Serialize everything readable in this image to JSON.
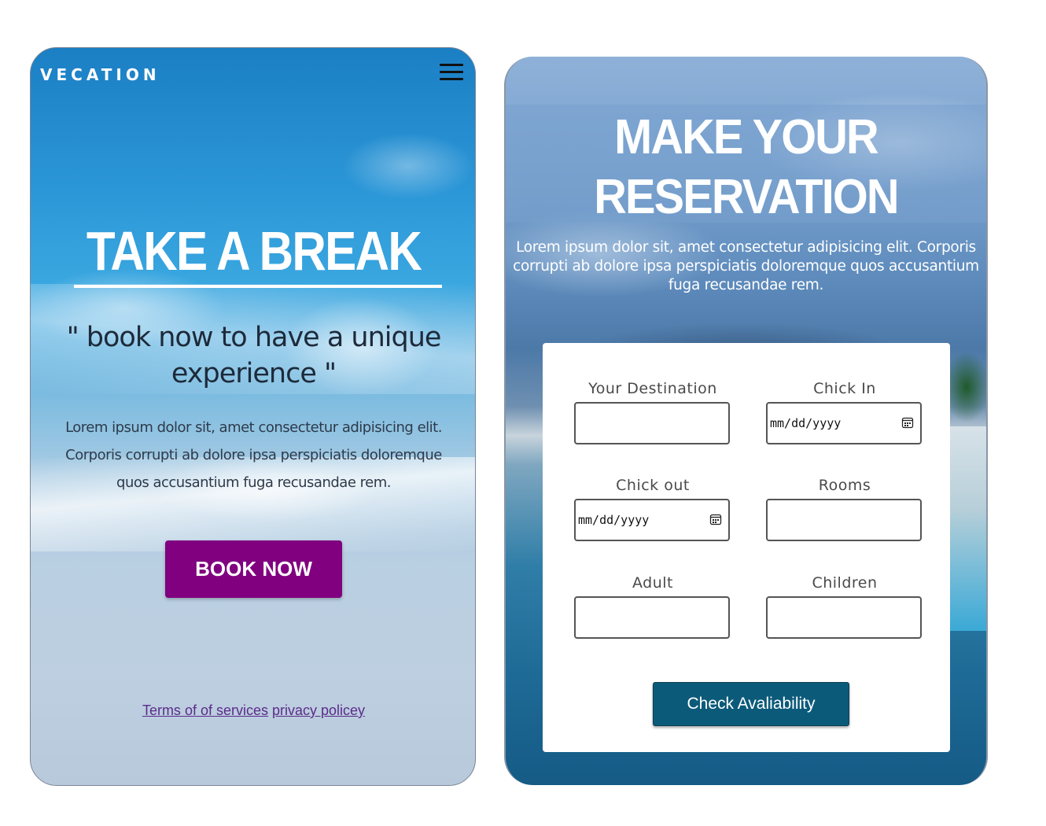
{
  "left": {
    "brand": "VECATION",
    "hero_title": "TAKE A BREAK",
    "hero_quote": "\" book now to have a unique experience \"",
    "hero_description": "Lorem ipsum dolor sit, amet consectetur adipisicing elit. Corporis corrupti ab dolore ipsa perspiciatis doloremque quos accusantium fuga recusandae rem.",
    "book_button": "BOOK NOW",
    "footer": {
      "terms": "Terms of of services",
      "privacy": "privacy policey"
    },
    "icons": {
      "menu": "hamburger-menu-icon"
    }
  },
  "right": {
    "title": "MAKE YOUR RESERVATION",
    "description": "Lorem ipsum dolor sit, amet consectetur adipisicing elit. Corporis corrupti ab dolore ipsa perspiciatis doloremque quos accusantium fuga recusandae rem.",
    "form": {
      "destination_label": "Your Destination",
      "checkin_label": "Chick In",
      "checkin_placeholder": "mm/dd/yyyy",
      "checkout_label": "Chick out",
      "checkout_placeholder": "mm/dd/yyyy",
      "rooms_label": "Rooms",
      "adult_label": "Adult",
      "children_label": "Children"
    },
    "check_button": "Check Avaliability",
    "icons": {
      "calendar": "calendar-icon"
    }
  },
  "colors": {
    "book_button": "#800080",
    "check_button": "#0c5a7a",
    "link": "#5b2c8a"
  }
}
